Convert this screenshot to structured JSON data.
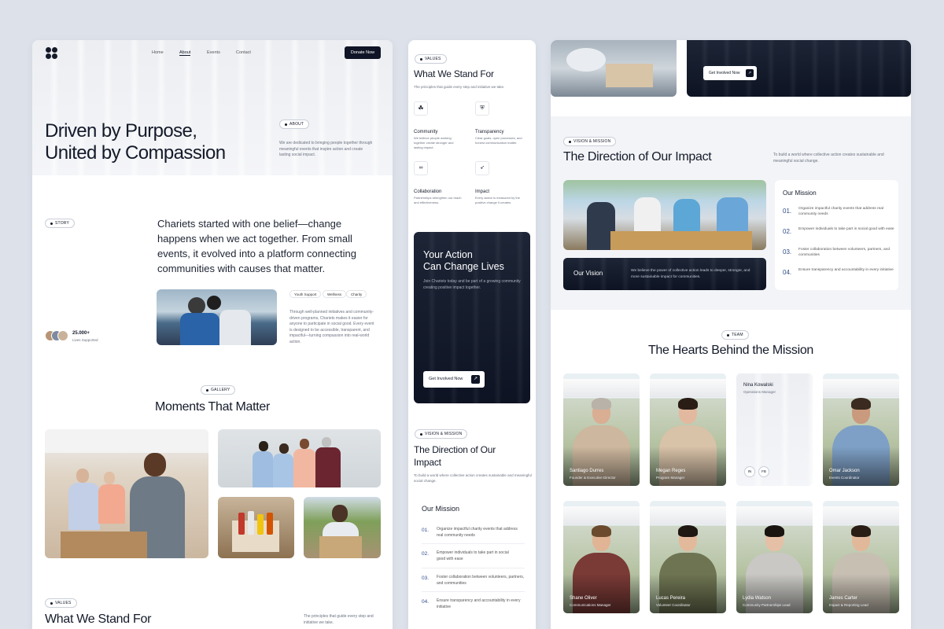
{
  "home": {
    "nav": {
      "home": "Home",
      "about": "About",
      "events": "Events",
      "contact": "Contact",
      "donate": "Donate Now"
    },
    "hero": {
      "title_line1": "Driven by Purpose,",
      "title_line2": "United by Compassion",
      "about_pill": "ABOUT",
      "about_text": "We are dedicated to bringing people together through meaningful events that inspire action and create lasting social impact."
    },
    "story": {
      "pill": "STORY",
      "heading": "Chariets started with one belief—change happens when we act together. From small events, it evolved into a platform connecting communities with causes that matter.",
      "tags": [
        "Youth Support",
        "Wellness",
        "Charity"
      ],
      "body": "Through well-planned initiatives and community-driven programs, Chariets makes it easier for anyone to participate in social good. Every event is designed to be accessible, transparent, and impactful—turning compassion into real-world action.",
      "stat_value": "25.000+",
      "stat_label": "Lives Supported"
    },
    "gallery": {
      "pill": "GALLERY",
      "title": "Moments That Matter"
    },
    "values": {
      "pill": "VALUES",
      "title": "What We Stand For",
      "subtitle": "The principles that guide every step and initiative we take."
    }
  },
  "mobile": {
    "values": {
      "pill": "VALUES",
      "title": "What We Stand For",
      "subtitle": "The principles that guide every step and initiative we take.",
      "items": [
        {
          "title": "Community",
          "text": "We believe people working together create stronger and lasting impact."
        },
        {
          "title": "Transparency",
          "text": "Clear goals, open processes, and honest communication matter."
        },
        {
          "title": "Collaboration",
          "text": "Partnerships strengthen our reach and effectiveness."
        },
        {
          "title": "Impact",
          "text": "Every action is measured by the positive change it creates."
        }
      ]
    },
    "cta": {
      "title_line1": "Your Action",
      "title_line2": "Can Change Lives",
      "text": "Join Chariets today and be part of a growing community creating positive impact together.",
      "button": "Get Involved Now"
    },
    "vision": {
      "pill": "VISION & MISSION",
      "title": "The Direction of Our Impact",
      "text": "To build a world where collective action creates sustainable and meaningful social change."
    },
    "mission": {
      "title": "Our Mission",
      "items": [
        {
          "num": "01.",
          "text": "Organize impactful charity events that address real community needs"
        },
        {
          "num": "02.",
          "text": "Empower individuals to take part in social good with ease"
        },
        {
          "num": "03.",
          "text": "Foster collaboration between volunteers, partners, and communities"
        },
        {
          "num": "04.",
          "text": "Ensure transparency and accountability in every initiative"
        }
      ]
    }
  },
  "right": {
    "cta_button": "Get Involved Now",
    "vision": {
      "pill": "VISION & MISSION",
      "title": "The Direction of Our Impact",
      "text": "To build a world where collective action creates sustainable and meaningful social change."
    },
    "our_vision": {
      "title": "Our Vision",
      "text": "We believe the power of collective action leads to deeper, stronger, and more sustainable impact for communities."
    },
    "mission": {
      "title": "Our Mission",
      "items": [
        {
          "num": "01.",
          "text": "Organize impactful charity events that address real community needs"
        },
        {
          "num": "02.",
          "text": "Empower individuals to take part in social good with ease"
        },
        {
          "num": "03.",
          "text": "Foster collaboration between volunteers, partners, and communities"
        },
        {
          "num": "04.",
          "text": "Ensure transparency and accountability in every initiative"
        }
      ]
    },
    "team": {
      "pill": "TEAM",
      "title": "The Hearts Behind the Mission",
      "members": [
        {
          "name": "Santiago Durres",
          "role": "Founder & Executive Director"
        },
        {
          "name": "Megan Reges",
          "role": "Program Manager"
        },
        {
          "name": "Nina Kowalski",
          "role": "Operations Manager"
        },
        {
          "name": "Omar Jackson",
          "role": "Events Coordinator"
        },
        {
          "name": "Shane Oliver",
          "role": "Communications Manager"
        },
        {
          "name": "Lucas Pereira",
          "role": "Volunteer Coordinator"
        },
        {
          "name": "Lydia Watson",
          "role": "Community Partnerships Lead"
        },
        {
          "name": "James Carter",
          "role": "Impact & Reporting Lead"
        }
      ],
      "social": [
        "IN",
        "FB"
      ]
    }
  },
  "colors": {
    "dark": "#0f1526",
    "accent": "#2c4a8a",
    "background": "#dde2ea"
  }
}
